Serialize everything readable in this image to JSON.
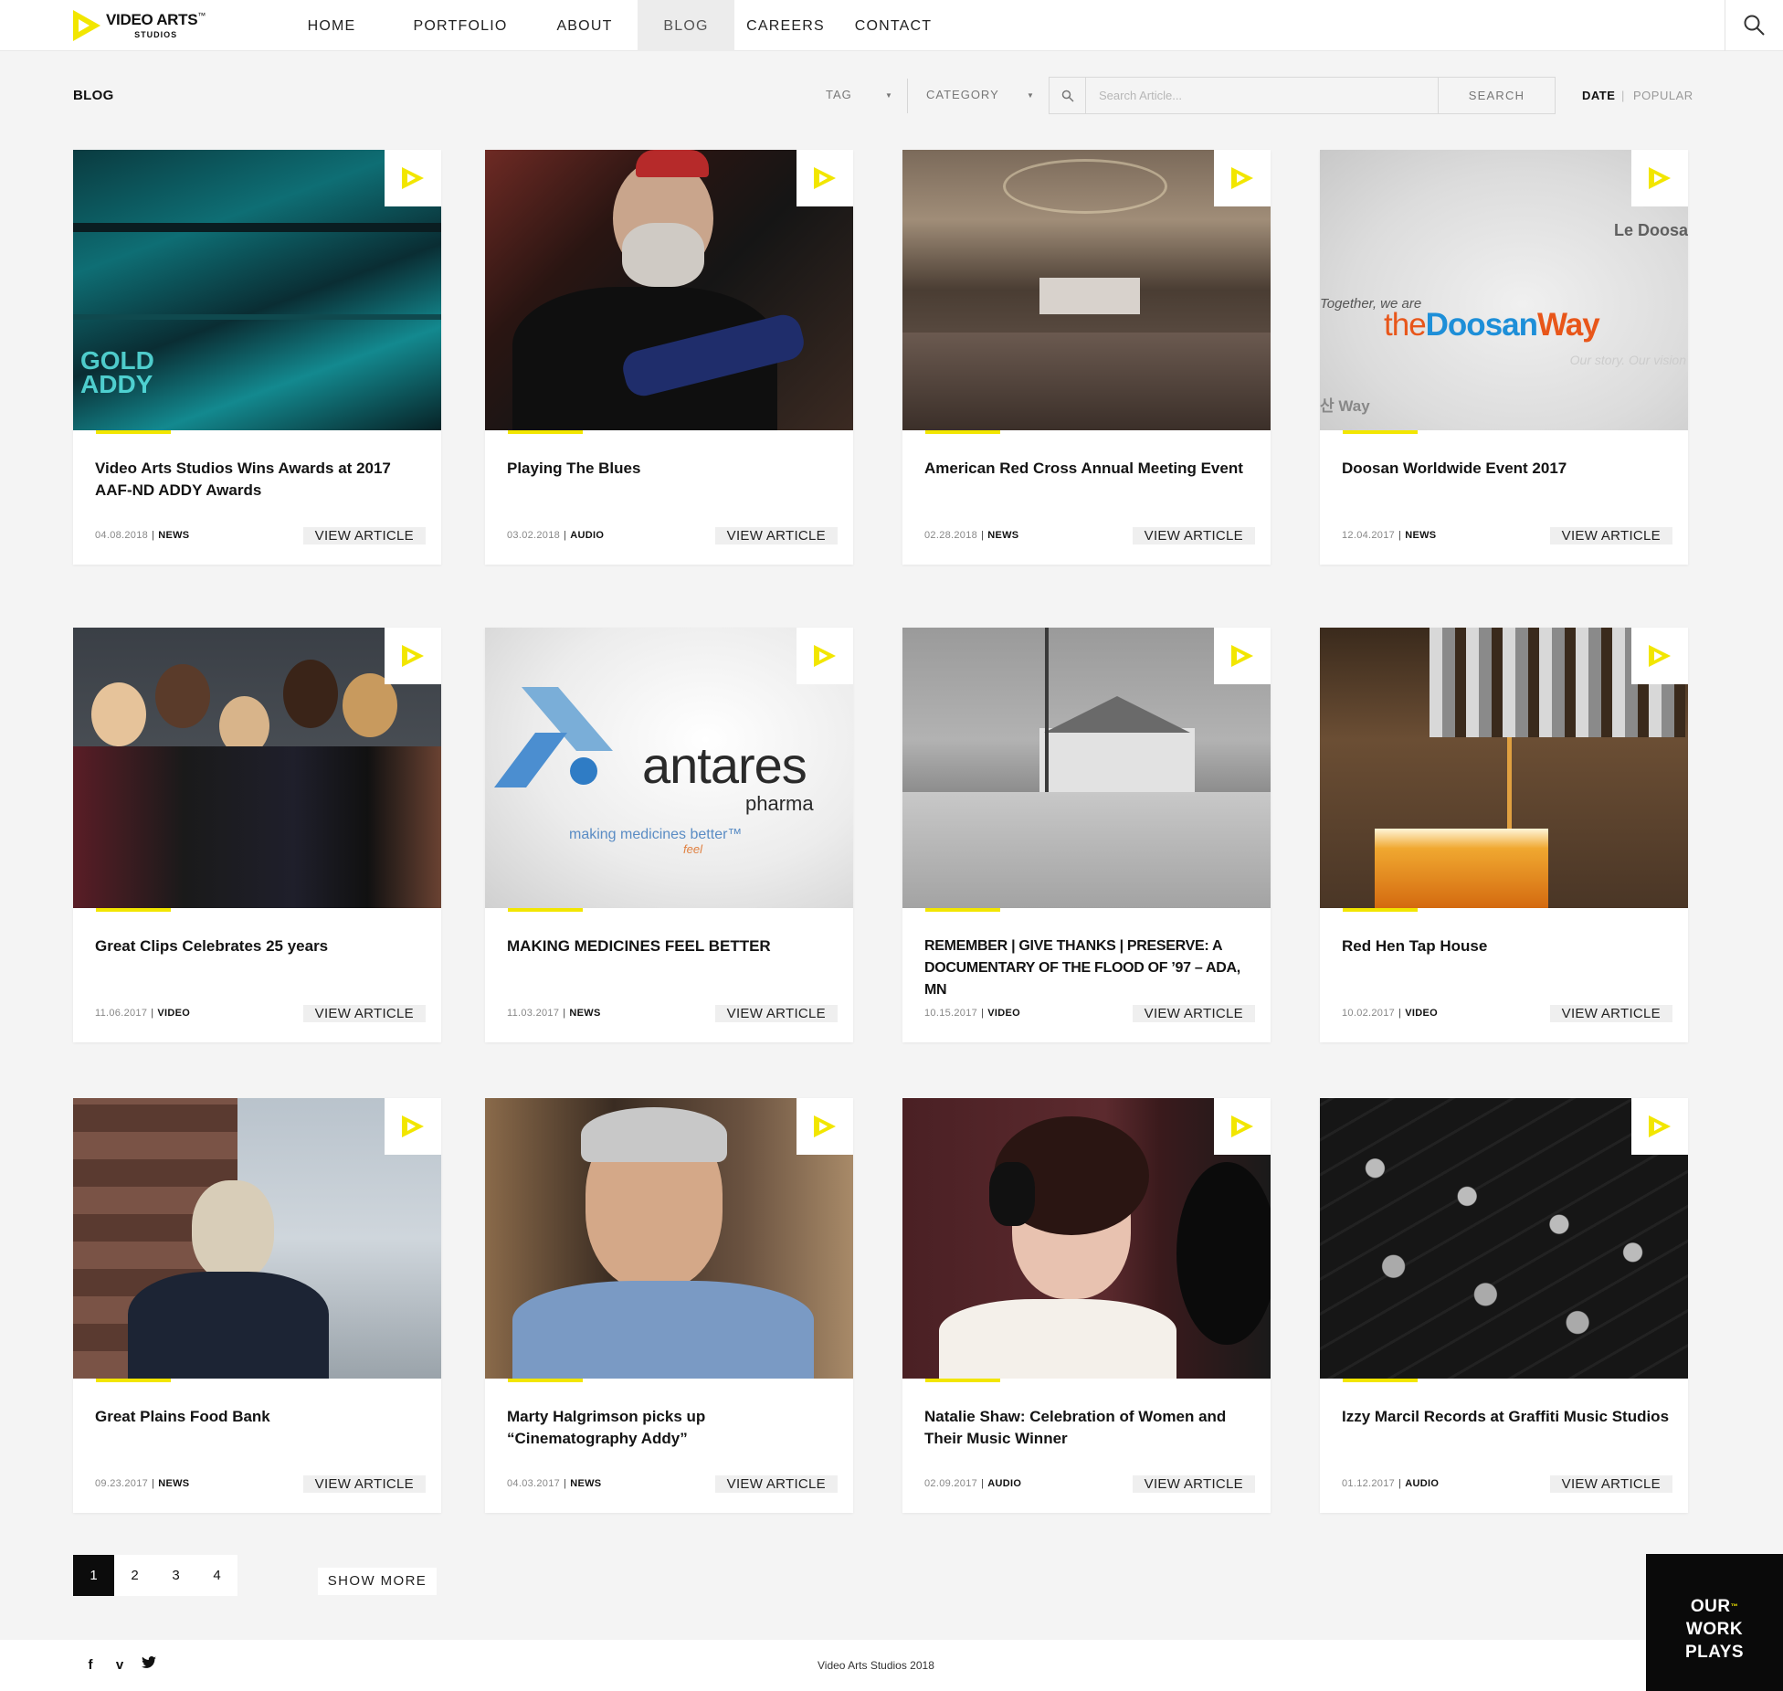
{
  "brand": {
    "name": "VIDEO ARTS",
    "tm": "™",
    "sub": "STUDIOS"
  },
  "nav": [
    {
      "label": "HOME"
    },
    {
      "label": "PORTFOLIO"
    },
    {
      "label": "ABOUT"
    },
    {
      "label": "BLOG",
      "active": true
    },
    {
      "label": "CAREERS"
    },
    {
      "label": "CONTACT"
    }
  ],
  "page_label": "BLOG",
  "filters": {
    "tag": "TAG",
    "category": "CATEGORY",
    "search_placeholder": "Search Article...",
    "search_button": "SEARCH",
    "sort_date": "DATE",
    "sort_sep": "|",
    "sort_popular": "POPULAR"
  },
  "colors": {
    "accent": "#f2e600",
    "dark": "#0a0a0a"
  },
  "icons": {
    "play": "play-triangle-icon",
    "search": "search-icon"
  },
  "cards": [
    {
      "title": "Video Arts Studios Wins Awards at 2017 AAF-ND ADDY Awards",
      "date": "04.08.2018",
      "category": "NEWS",
      "button": "VIEW ARTICLE"
    },
    {
      "title": "Playing The Blues",
      "date": "03.02.2018",
      "category": "AUDIO",
      "button": "VIEW ARTICLE"
    },
    {
      "title": "American Red Cross Annual Meeting Event",
      "date": "02.28.2018",
      "category": "NEWS",
      "button": "VIEW ARTICLE"
    },
    {
      "title": "Doosan Worldwide Event 2017",
      "date": "12.04.2017",
      "category": "NEWS",
      "button": "VIEW ARTICLE"
    },
    {
      "title": "Great Clips Celebrates 25 years",
      "date": "11.06.2017",
      "category": "VIDEO",
      "button": "VIEW ARTICLE"
    },
    {
      "title": "MAKING MEDICINES FEEL BETTER",
      "date": "11.03.2017",
      "category": "NEWS",
      "button": "VIEW ARTICLE"
    },
    {
      "title": "REMEMBER | GIVE THANKS | PRESERVE: A DOCUMENTARY OF THE FLOOD OF ’97 – ADA, MN",
      "date": "10.15.2017",
      "category": "VIDEO",
      "button": "VIEW ARTICLE"
    },
    {
      "title": "Red Hen Tap House",
      "date": "10.02.2017",
      "category": "VIDEO",
      "button": "VIEW ARTICLE"
    },
    {
      "title": "Great Plains Food Bank",
      "date": "09.23.2017",
      "category": "NEWS",
      "button": "VIEW ARTICLE"
    },
    {
      "title": "Marty Halgrimson picks up “Cinematography Addy”",
      "date": "04.03.2017",
      "category": "NEWS",
      "button": "VIEW ARTICLE"
    },
    {
      "title": "Natalie Shaw: Celebration of Women and Their Music Winner",
      "date": "02.09.2017",
      "category": "AUDIO",
      "button": "VIEW ARTICLE"
    },
    {
      "title": "Izzy Marcil Records at Graffiti Music Studios",
      "date": "01.12.2017",
      "category": "AUDIO",
      "button": "VIEW ARTICLE"
    }
  ],
  "thumb_text": {
    "addy": [
      "GOLD",
      "ADDY"
    ],
    "doosan": {
      "together": "Together, we are",
      "the": "the",
      "doosan": "Doosan",
      "way": "Way",
      "le": "Le Doosa",
      "story": "Our story. Our vision",
      "hangul": "산 Way"
    },
    "antares": {
      "name": "antares",
      "pharma": "pharma",
      "tagline": "making medicines better™",
      "feel": "feel"
    }
  },
  "pagination": {
    "pages": [
      "1",
      "2",
      "3",
      "4"
    ],
    "active": "1",
    "show_more": "SHOW MORE"
  },
  "footer": {
    "copyright": "Video Arts Studios 2018",
    "social": [
      {
        "glyph": "f",
        "name": "facebook"
      },
      {
        "glyph": "v",
        "name": "vimeo"
      },
      {
        "glyph": "🐦",
        "name": "twitter"
      }
    ]
  },
  "promo": {
    "line1": "OUR",
    "tm": "™",
    "line2": "WORK",
    "line3": "PLAYS"
  }
}
